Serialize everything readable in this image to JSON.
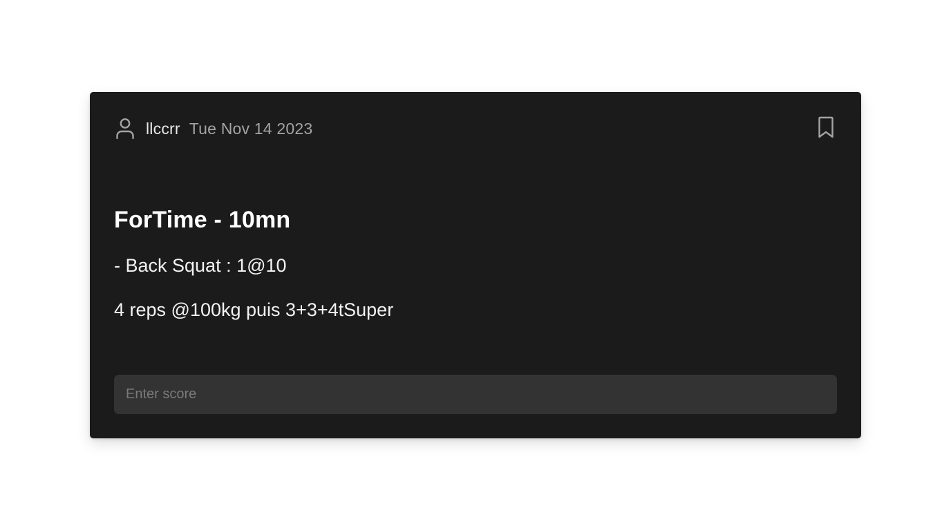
{
  "post": {
    "username": "llccrr",
    "date": "Tue Nov 14 2023",
    "title": "ForTime - 10mn",
    "lines": [
      "- Back Squat : 1@10",
      "4 reps @100kg puis 3+3+4tSuper"
    ],
    "score_input": {
      "value": "",
      "placeholder": "Enter score"
    }
  },
  "icons": {
    "user": "user-icon",
    "bookmark": "bookmark-icon"
  },
  "colors": {
    "card_background": "#1b1b1b",
    "input_background": "#333333",
    "page_background": "#ffffff",
    "muted_text": "#a3a3a3"
  }
}
